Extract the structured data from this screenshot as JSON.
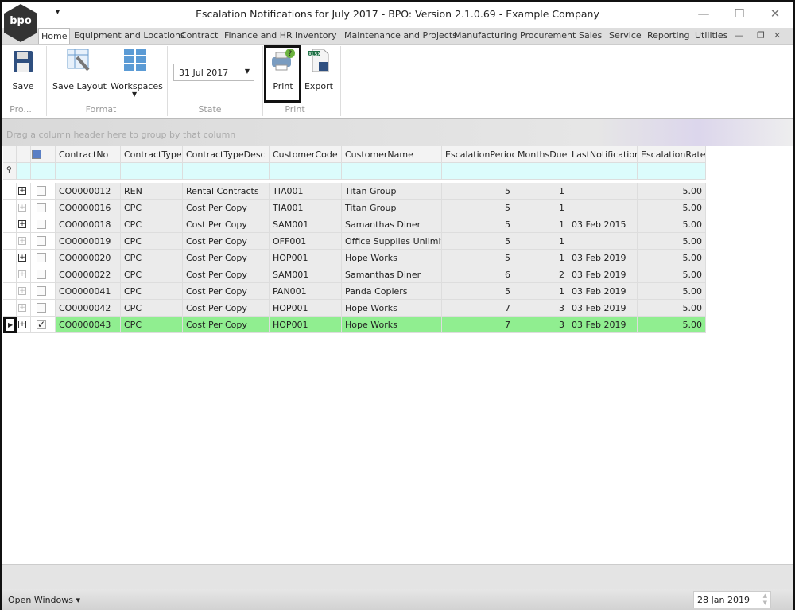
{
  "window": {
    "title": "Escalation Notifications for July 2017 - BPO: Version 2.1.0.69 - Example Company",
    "logo": "bpo",
    "qat": "▾",
    "min": "—",
    "max": "☐",
    "close": "✕"
  },
  "tabs": [
    "Home",
    "Equipment and Locations",
    "Contract",
    "Finance and HR",
    "Inventory",
    "Maintenance and Projects",
    "Manufacturing",
    "Procurement",
    "Sales",
    "Service",
    "Reporting",
    "Utilities"
  ],
  "mdi": {
    "min": "—",
    "restore": "❐",
    "close": "✕"
  },
  "ribbon": {
    "save": "Save",
    "save_layout": "Save Layout",
    "workspaces": "Workspaces",
    "date": "31 Jul 2017",
    "print": "Print",
    "export": "Export",
    "xlsx": "XLSX",
    "groups": {
      "pro": "Pro...",
      "format": "Format",
      "state": "State",
      "print": "Print"
    }
  },
  "grid": {
    "group_hint": "Drag a column header here to group by that column",
    "columns": [
      "ContractNo",
      "ContractType",
      "ContractTypeDesc",
      "CustomerCode",
      "CustomerName",
      "EscalationPeriod",
      "MonthsDue",
      "LastNotification",
      "EscalationRate"
    ],
    "rows": [
      [
        "CO0000012",
        "REN",
        "Rental Contracts",
        "TIA001",
        "Titan Group",
        "5",
        "1",
        "",
        "5.00"
      ],
      [
        "CO0000016",
        "CPC",
        "Cost Per Copy",
        "TIA001",
        "Titan Group",
        "5",
        "1",
        "",
        "5.00"
      ],
      [
        "CO0000018",
        "CPC",
        "Cost Per Copy",
        "SAM001",
        "Samanthas Diner",
        "5",
        "1",
        "03 Feb 2015",
        "5.00"
      ],
      [
        "CO0000019",
        "CPC",
        "Cost Per Copy",
        "OFF001",
        "Office Supplies Unlimited",
        "5",
        "1",
        "",
        "5.00"
      ],
      [
        "CO0000020",
        "CPC",
        "Cost Per Copy",
        "HOP001",
        "Hope Works",
        "5",
        "1",
        "03 Feb 2019",
        "5.00"
      ],
      [
        "CO0000022",
        "CPC",
        "Cost Per Copy",
        "SAM001",
        "Samanthas Diner",
        "6",
        "2",
        "03 Feb 2019",
        "5.00"
      ],
      [
        "CO0000041",
        "CPC",
        "Cost Per Copy",
        "PAN001",
        "Panda Copiers",
        "5",
        "1",
        "03 Feb 2019",
        "5.00"
      ],
      [
        "CO0000042",
        "CPC",
        "Cost Per Copy",
        "HOP001",
        "Hope Works",
        "7",
        "3",
        "03 Feb 2019",
        "5.00"
      ],
      [
        "CO0000043",
        "CPC",
        "Cost Per Copy",
        "HOP001",
        "Hope Works",
        "7",
        "3",
        "03 Feb 2019",
        "5.00"
      ]
    ],
    "expandable": [
      true,
      false,
      true,
      false,
      true,
      false,
      false,
      false,
      true
    ],
    "checked": [
      false,
      false,
      false,
      false,
      false,
      false,
      false,
      false,
      true
    ],
    "selected_row": 8
  },
  "status": {
    "open_windows": "Open Windows ▾",
    "date": "28 Jan 2019"
  }
}
